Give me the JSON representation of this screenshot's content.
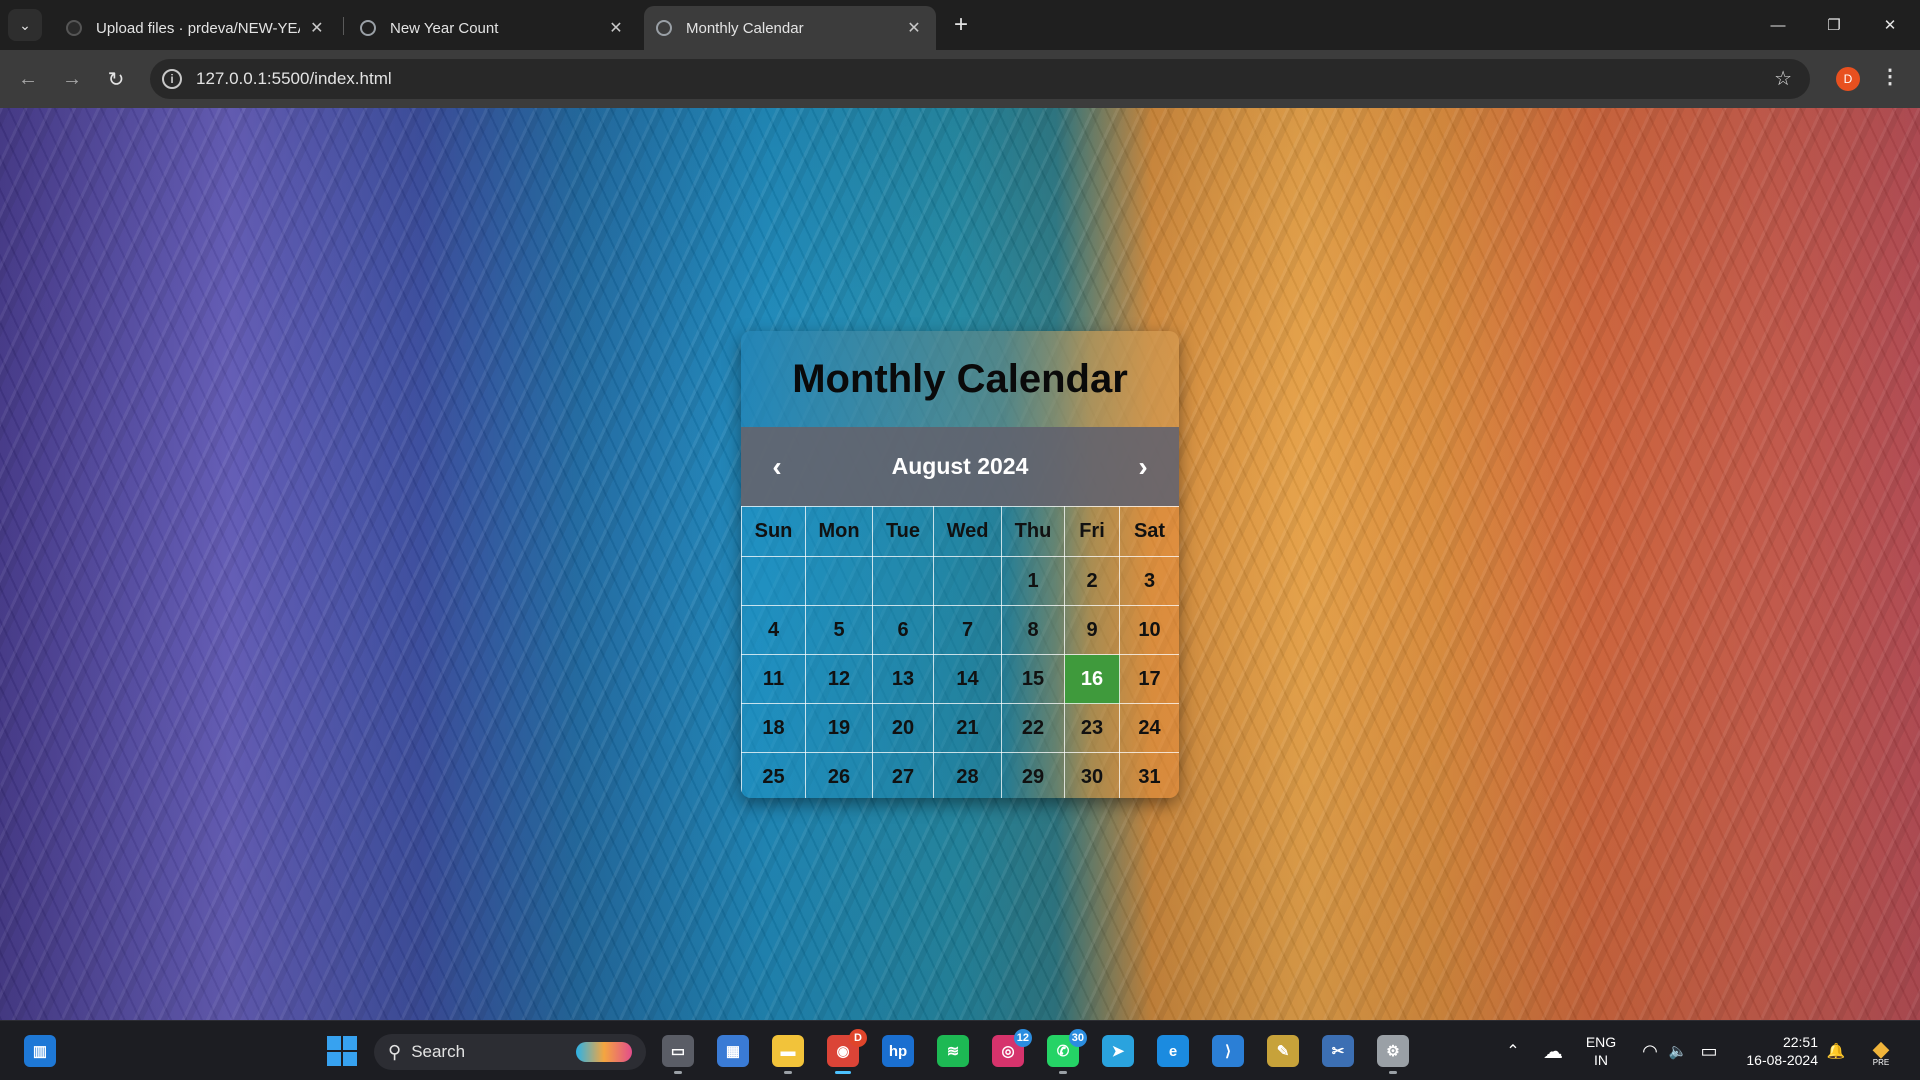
{
  "browser": {
    "tabs": [
      {
        "title": "Upload files · prdeva/NEW-YEAR",
        "active": false
      },
      {
        "title": "New Year Count",
        "active": false
      },
      {
        "title": "Monthly Calendar",
        "active": true
      }
    ],
    "url": "127.0.0.1:5500/index.html",
    "profile_initial": "D",
    "icons": {
      "tab_search": "chevron-down-icon",
      "new_tab": "plus-icon",
      "back": "back-arrow-icon",
      "forward": "forward-arrow-icon",
      "reload": "reload-icon",
      "site_info": "info-icon",
      "bookmark": "star-icon",
      "menu": "kebab-menu-icon"
    },
    "glyphs": {
      "close": "✕",
      "new_tab": "+",
      "back": "←",
      "forward": "→",
      "reload": "↻",
      "info": "i",
      "star": "☆",
      "menu": "⋮",
      "minimize": "—",
      "restore": "❐",
      "window_close": "✕",
      "chevron": "⌄"
    }
  },
  "calendar": {
    "title": "Monthly Calendar",
    "month_label": "August 2024",
    "prev": "‹",
    "next": "›",
    "weekdays": [
      "Sun",
      "Mon",
      "Tue",
      "Wed",
      "Thu",
      "Fri",
      "Sat"
    ],
    "weeks": [
      [
        "",
        "",
        "",
        "",
        "1",
        "2",
        "3"
      ],
      [
        "4",
        "5",
        "6",
        "7",
        "8",
        "9",
        "10"
      ],
      [
        "11",
        "12",
        "13",
        "14",
        "15",
        "16",
        "17"
      ],
      [
        "18",
        "19",
        "20",
        "21",
        "22",
        "23",
        "24"
      ],
      [
        "25",
        "26",
        "27",
        "28",
        "29",
        "30",
        "31"
      ]
    ],
    "today": "16",
    "today_color": "#3f9a3c"
  },
  "taskbar": {
    "search_label": "Search",
    "search_glyph": "⚲",
    "apps": [
      {
        "name": "task-view-icon",
        "glyph": "▭",
        "color": "#5a5d66"
      },
      {
        "name": "microsoft-store-icon",
        "glyph": "▦",
        "color": "#3a7bd5"
      },
      {
        "name": "file-explorer-icon",
        "glyph": "▬",
        "color": "#f2c33a"
      },
      {
        "name": "chrome-icon",
        "glyph": "◉",
        "color": "#db4437",
        "badge": "D"
      },
      {
        "name": "myhp-icon",
        "glyph": "hp",
        "color": "#1a6fd0"
      },
      {
        "name": "spotify-icon",
        "glyph": "≋",
        "color": "#1db954"
      },
      {
        "name": "instagram-icon",
        "glyph": "◎",
        "color": "#d6336c",
        "badge": "12"
      },
      {
        "name": "whatsapp-icon",
        "glyph": "✆",
        "color": "#25d366",
        "badge": "30"
      },
      {
        "name": "telegram-icon",
        "glyph": "➤",
        "color": "#2aa3de"
      },
      {
        "name": "edge-icon",
        "glyph": "e",
        "color": "#1b8be0"
      },
      {
        "name": "vscode-icon",
        "glyph": "⟩",
        "color": "#2b7fd6"
      },
      {
        "name": "photos-icon",
        "glyph": "✎",
        "color": "#c7a23a"
      },
      {
        "name": "snipping-tool-icon",
        "glyph": "✂",
        "color": "#3c6fb3"
      },
      {
        "name": "settings-icon",
        "glyph": "⚙",
        "color": "#9aa0a6"
      }
    ],
    "tray": {
      "overflow_glyph": "⌃",
      "cloud_glyph": "☁",
      "lang_line1": "ENG",
      "lang_line2": "IN",
      "wifi_glyph": "◠",
      "volume_glyph": "🔈",
      "battery_glyph": "▭",
      "time": "22:51",
      "date": "16-08-2024",
      "notification_glyph": "🔔",
      "copilot_glyph": "◆",
      "copilot_label": "PRE"
    }
  }
}
